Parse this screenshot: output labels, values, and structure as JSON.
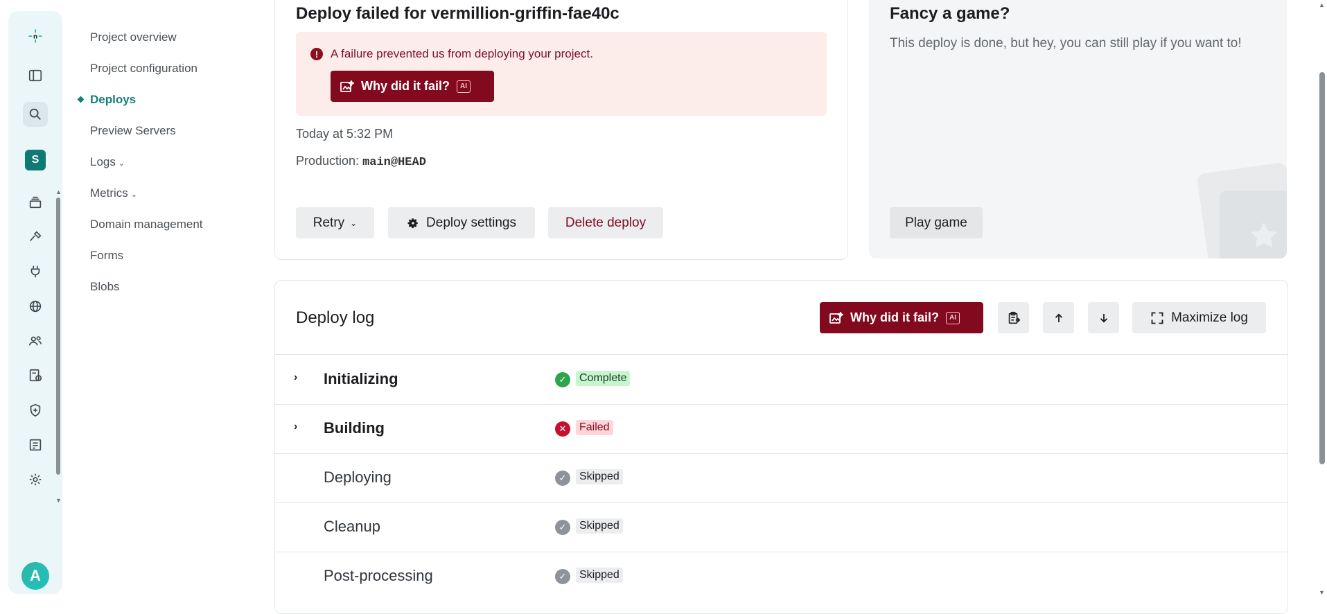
{
  "sidebar": {
    "site_initial": "S",
    "avatar_initial": "A",
    "items": [
      {
        "label": "Project overview"
      },
      {
        "label": "Project configuration"
      },
      {
        "label": "Deploys"
      },
      {
        "label": "Preview Servers"
      },
      {
        "label": "Logs"
      },
      {
        "label": "Metrics"
      },
      {
        "label": "Domain management"
      },
      {
        "label": "Forms"
      },
      {
        "label": "Blobs"
      }
    ]
  },
  "deploy": {
    "title": "Deploy failed for vermillion-griffin-fae40c",
    "alert_text": "A failure prevented us from deploying your project.",
    "why_fail_label": "Why did it fail?",
    "ai_tag": "AI",
    "time": "Today at 5:32 PM",
    "production_label": "Production:",
    "branch": "main@HEAD",
    "retry_label": "Retry",
    "settings_label": "Deploy settings",
    "delete_label": "Delete deploy"
  },
  "game": {
    "title": "Fancy a game?",
    "subtitle": "This deploy is done, but hey, you can still play if you want to!",
    "play_label": "Play game"
  },
  "log": {
    "title": "Deploy log",
    "why_fail_label": "Why did it fail?",
    "ai_tag": "AI",
    "maximize_label": "Maximize log",
    "steps": [
      {
        "name": "Initializing",
        "status": "Complete"
      },
      {
        "name": "Building",
        "status": "Failed"
      },
      {
        "name": "Deploying",
        "status": "Skipped"
      },
      {
        "name": "Cleanup",
        "status": "Skipped"
      },
      {
        "name": "Post-processing",
        "status": "Skipped"
      }
    ]
  },
  "colors": {
    "brand_teal": "#14807a",
    "danger": "#83091f",
    "success": "#2ea44f"
  }
}
